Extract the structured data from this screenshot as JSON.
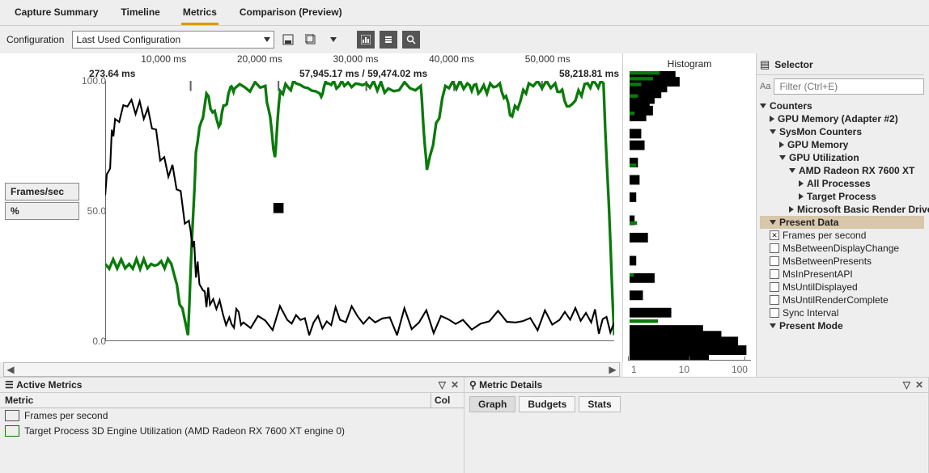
{
  "tabs": {
    "capture_summary": "Capture Summary",
    "timeline": "Timeline",
    "metrics": "Metrics",
    "comparison": "Comparison (Preview)"
  },
  "configuration_label": "Configuration",
  "configuration_value": "Last Used Configuration",
  "chart": {
    "ticks": [
      "10,000 ms",
      "20,000 ms",
      "30,000 ms",
      "40,000 ms",
      "50,000 ms"
    ],
    "readout_left": "273.64 ms",
    "readout_mid": "57,945.17 ms / 59,474.02 ms",
    "readout_right": "58,218.81 ms",
    "y_ticks": [
      "100.0",
      "50.0",
      "0.0"
    ],
    "left_label_1": "Frames/sec",
    "left_label_2": "%"
  },
  "histogram": {
    "title": "Histogram",
    "ticks": [
      "1",
      "10",
      "100"
    ]
  },
  "selector": {
    "title": "Selector",
    "filter_placeholder": "Filter (Ctrl+E)",
    "nodes": {
      "counters": "Counters",
      "gpu_mem_adapter": "GPU Memory (Adapter #2)",
      "sysmon": "SysMon Counters",
      "gpu_memory": "GPU Memory",
      "gpu_util": "GPU Utilization",
      "amd": "AMD Radeon RX 7600 XT",
      "all_proc": "All Processes",
      "target_proc": "Target Process",
      "ms_basic": "Microsoft Basic Render Driver",
      "present_data": "Present Data",
      "fps": "Frames per second",
      "ms_disp": "MsBetweenDisplayChange",
      "ms_presents": "MsBetweenPresents",
      "ms_inpresent": "MsInPresentAPI",
      "ms_until_disp": "MsUntilDisplayed",
      "ms_until_render": "MsUntilRenderComplete",
      "sync_interval": "Sync Interval",
      "present_mode": "Present Mode"
    }
  },
  "active_metrics": {
    "title": "Active Metrics",
    "col_metric": "Metric",
    "col_col": "Col",
    "row_fps": "Frames per second",
    "row_target": "Target Process 3D Engine Utilization (AMD Radeon RX 7600 XT engine 0)"
  },
  "metric_details": {
    "title": "Metric Details",
    "tab_graph": "Graph",
    "tab_budgets": "Budgets",
    "tab_stats": "Stats"
  },
  "chart_data": {
    "type": "line",
    "title": "",
    "xlabel": "ms",
    "ylabel": "Frames/sec | %",
    "xlim": [
      273.64,
      58218.81
    ],
    "ylim": [
      0,
      100
    ],
    "y_ticks": [
      0,
      50,
      100
    ],
    "x_ticks_ms": [
      10000,
      20000,
      30000,
      40000,
      50000
    ],
    "cursor_ms": 57945.17,
    "selection_end_ms": 59474.02,
    "series": [
      {
        "name": "Target Process 3D Engine Utilization (AMD Radeon RX 7600 XT engine 0)",
        "color": "#0a7a0a",
        "unit": "%",
        "x": [
          273,
          3000,
          5500,
          7800,
          9700,
          10600,
          11800,
          13200,
          14300,
          15000,
          18500,
          19600,
          20200,
          22000,
          24700,
          25700,
          27500,
          30000,
          32500,
          36200,
          36900,
          39000,
          41500,
          43000,
          45200,
          46600,
          48500,
          51500,
          53100,
          55200,
          57000,
          58218
        ],
        "values": [
          28,
          28,
          28,
          28,
          0,
          72,
          95,
          82,
          95,
          97,
          98,
          70,
          96,
          99,
          95,
          99,
          98,
          99,
          97,
          98,
          65,
          98,
          99,
          96,
          99,
          86,
          99,
          99,
          90,
          99,
          99,
          0
        ],
        "note": "Approximate values read from plot; long near-100% plateau with periodic dips in 60–85% range and a flat ~28% segment before 10,000 ms."
      },
      {
        "name": "Frames per second",
        "color": "#000000",
        "unit": "fps",
        "x": [
          273,
          1400,
          4200,
          7000,
          9800,
          11000,
          12200,
          14400,
          16000,
          21000,
          24000,
          27000,
          31000,
          36000,
          41000,
          47000,
          52000,
          55600,
          58218
        ],
        "values": [
          55,
          85,
          92,
          70,
          45,
          20,
          12,
          7,
          5,
          6,
          5,
          6,
          5,
          5,
          6,
          5,
          6,
          5,
          5
        ],
        "note": "Highly noisy grey series; early segment oscillates 45–95 then collapses to low ~5 fps with small spikes for remainder."
      }
    ],
    "histogram": {
      "type": "horizontal-bar",
      "x_scale": "log",
      "x_ticks": [
        1,
        10,
        100
      ],
      "bars_approx_y_pct": [
        100,
        98,
        96,
        94,
        92,
        90,
        88,
        86,
        80,
        76,
        70,
        64,
        58,
        50,
        44,
        36,
        30,
        24,
        18,
        12,
        10,
        8,
        5,
        3
      ],
      "bars_approx_len": [
        55,
        60,
        45,
        38,
        30,
        24,
        28,
        20,
        14,
        18,
        10,
        12,
        8,
        6,
        22,
        8,
        30,
        16,
        50,
        88,
        110,
        130,
        140,
        95
      ],
      "green_overlay_y_pct": [
        100,
        98,
        96,
        92,
        86,
        68,
        48,
        30,
        14
      ],
      "green_overlay_len": [
        36,
        28,
        14,
        10,
        6,
        8,
        9,
        5,
        34
      ]
    }
  }
}
